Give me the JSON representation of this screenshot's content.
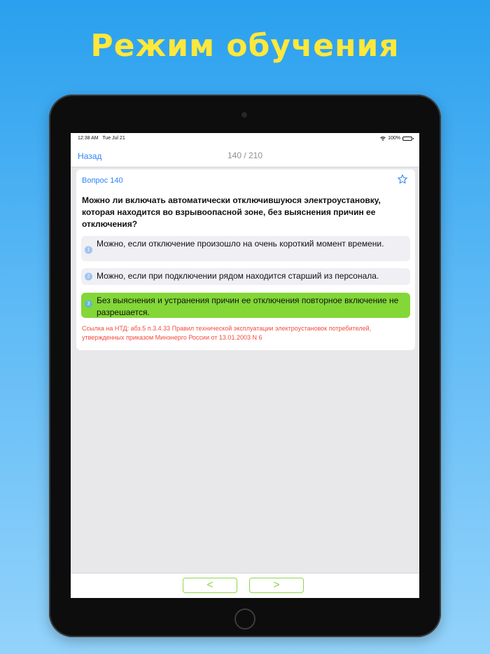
{
  "promo": {
    "title": "Режим обучения"
  },
  "status_bar": {
    "time": "12:38 AM   Tue Jul 21",
    "battery": "100%"
  },
  "nav": {
    "back_label": "Назад",
    "progress": "140 / 210"
  },
  "question": {
    "number_label": "Вопрос 140",
    "text": "Можно ли включать автоматически отключившуюся электроустановку, которая находится во взрывоопасной зоне, без выяснения причин ее отключения?",
    "answers": [
      {
        "num": "1",
        "text": "Можно, если отключение произошло на очень короткий момент времени.",
        "correct": false
      },
      {
        "num": "2",
        "text": "Можно, если при подключении рядом находится старший из персонала.",
        "correct": false
      },
      {
        "num": "3",
        "text": "Без выяснения и устранения причин ее отключения повторное включение не разрешается.",
        "correct": true
      }
    ],
    "reference": "Ссылка на НТД: абз.5 п.3.4.33 Правил технической эксплуатации электроустановок потребителей, утвержденных приказом Минэнерго России от 13.01.2003 N 6"
  },
  "bottom_nav": {
    "prev_label": "<",
    "next_label": ">"
  },
  "colors": {
    "accent_blue": "#2f86f6",
    "correct_green": "#83d737",
    "reference_red": "#f24b3e",
    "promo_yellow": "#ffe83b"
  },
  "icons": {
    "favorite": "star-outline-icon",
    "wifi": "wifi-icon",
    "battery": "battery-icon"
  }
}
